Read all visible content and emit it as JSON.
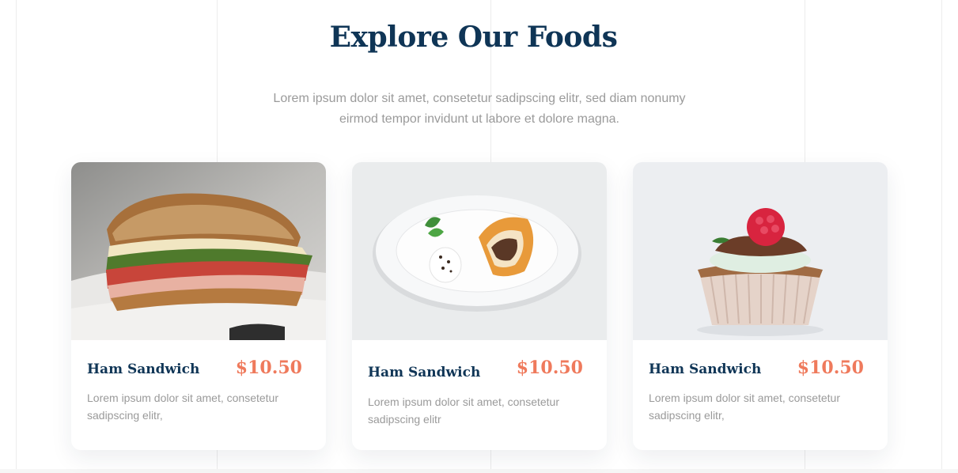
{
  "section": {
    "title": "Explore Our Foods",
    "subtitle_line1": "Lorem ipsum dolor sit amet, consetetur sadipscing elitr, sed diam nonumy",
    "subtitle_line2": "eirmod tempor invidunt ut labore et dolore magna."
  },
  "cards": [
    {
      "image": "ham-sandwich-photo",
      "name": "Ham Sandwich",
      "price": "$10.50",
      "desc_line1": "Lorem ipsum dolor sit amet, consetetur",
      "desc_line2": "sadipscing elitr,"
    },
    {
      "image": "cake-slice-plate-photo",
      "name": "Ham Sandwich",
      "price": "$10.50",
      "desc_line1": "Lorem ipsum dolor sit amet, consetetur",
      "desc_line2": "sadipscing elitr"
    },
    {
      "image": "raspberry-cupcake-photo",
      "name": "Ham Sandwich",
      "price": "$10.50",
      "desc_line1": "Lorem ipsum dolor sit amet, consetetur",
      "desc_line2": "sadipscing elitr,"
    }
  ],
  "colors": {
    "heading": "#0f3556",
    "price": "#ef7a5c",
    "muted_text": "#9a9a9a"
  }
}
